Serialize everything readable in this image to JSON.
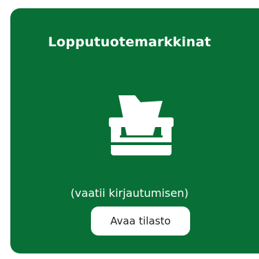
{
  "card": {
    "title": "Lopputuotemarkkinat",
    "icon": "file-tray-icon",
    "note": "(vaatii kirjautumisen)",
    "button_label": "Avaa tilasto",
    "background_color": "#087036",
    "button_color": "#ffffff"
  }
}
